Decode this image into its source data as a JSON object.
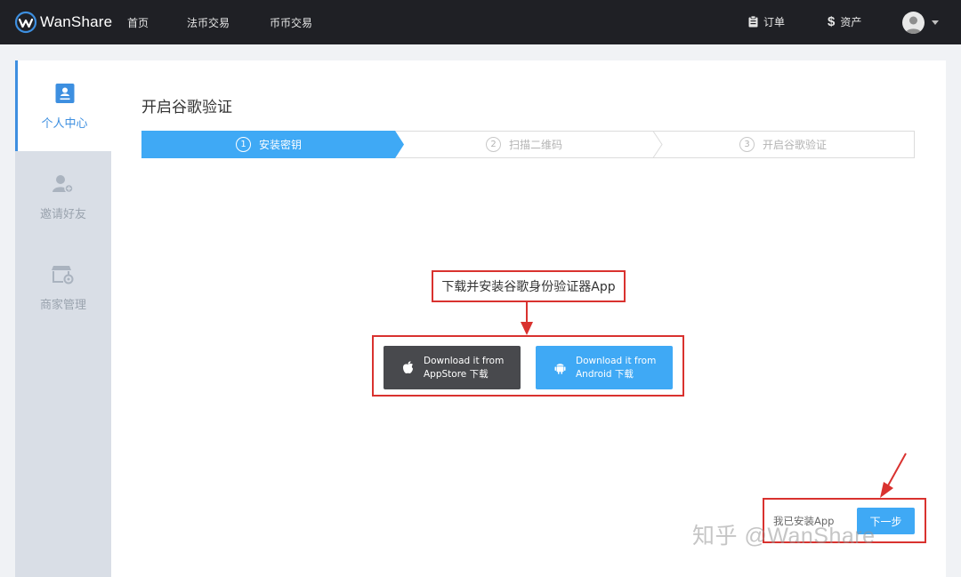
{
  "brand": {
    "name": "WanShare",
    "accent": "#3d8fe0"
  },
  "nav": {
    "items": [
      "首页",
      "法币交易",
      "币币交易"
    ],
    "orders_label": "订单",
    "assets_label": "资产"
  },
  "sidebar": {
    "items": [
      {
        "label": "个人中心",
        "icon": "user-card-icon",
        "active": true
      },
      {
        "label": "邀请好友",
        "icon": "user-add-icon",
        "active": false
      },
      {
        "label": "商家管理",
        "icon": "shop-settings-icon",
        "active": false
      }
    ]
  },
  "main": {
    "title": "开启谷歌验证",
    "steps": [
      {
        "num": "1",
        "label": "安装密钥",
        "active": true
      },
      {
        "num": "2",
        "label": "扫描二维码",
        "active": false
      },
      {
        "num": "3",
        "label": "开启谷歌验证",
        "active": false
      }
    ],
    "instruction": "下载并安装谷歌身份验证器App",
    "downloads": {
      "ios": {
        "line1": "Download it from",
        "line2": "AppStore 下载",
        "icon": "apple-icon"
      },
      "android": {
        "line1": "Download it from",
        "line2": "Android 下载",
        "icon": "android-icon"
      }
    },
    "installed_label": "我已安装App",
    "next_label": "下一步"
  },
  "watermark": "知乎 @WanShare",
  "colors": {
    "highlight_red": "#d9322f",
    "primary_blue": "#3fa9f5",
    "dark_button": "#48494d"
  }
}
